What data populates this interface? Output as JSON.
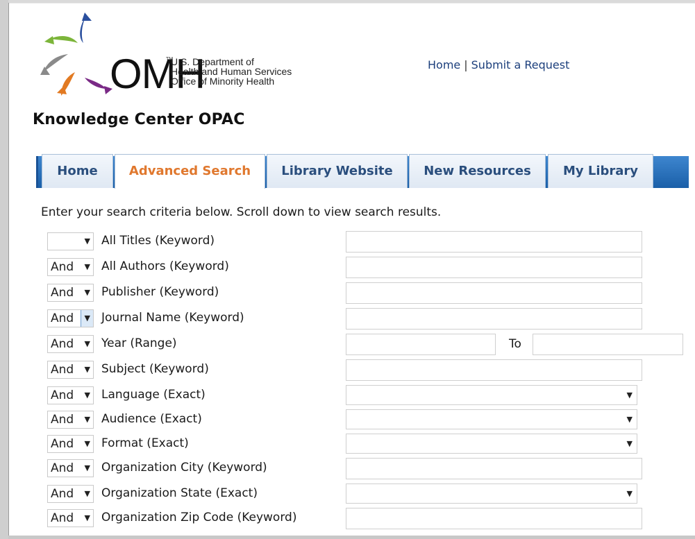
{
  "logo": {
    "letters": "OMH",
    "superscript": "TM",
    "line1": "U.S. Department of",
    "line2": "Health and Human Services",
    "line3": "Office of Minority Health"
  },
  "top_links": {
    "home": "Home",
    "separator": "|",
    "submit": "Submit a Request"
  },
  "page_title": "Knowledge Center OPAC",
  "tabs": [
    {
      "label": "Home",
      "active": false
    },
    {
      "label": "Advanced Search",
      "active": true
    },
    {
      "label": "Library Website",
      "active": false
    },
    {
      "label": "New Resources",
      "active": false
    },
    {
      "label": "My Library",
      "active": false
    }
  ],
  "instructions": "Enter your search criteria below. Scroll down to view search results.",
  "to_label": "To",
  "rows": [
    {
      "operator": "",
      "label": "All Titles (Keyword)",
      "input": "text"
    },
    {
      "operator": "And",
      "label": "All Authors (Keyword)",
      "input": "text"
    },
    {
      "operator": "And",
      "label": "Publisher (Keyword)",
      "input": "text"
    },
    {
      "operator": "And",
      "label": "Journal Name (Keyword)",
      "input": "text"
    },
    {
      "operator": "And",
      "label": "Year (Range)",
      "input": "range"
    },
    {
      "operator": "And",
      "label": "Subject (Keyword)",
      "input": "text"
    },
    {
      "operator": "And",
      "label": "Language (Exact)",
      "input": "select"
    },
    {
      "operator": "And",
      "label": "Audience (Exact)",
      "input": "select"
    },
    {
      "operator": "And",
      "label": "Format (Exact)",
      "input": "select"
    },
    {
      "operator": "And",
      "label": "Organization City (Keyword)",
      "input": "text"
    },
    {
      "operator": "And",
      "label": "Organization State (Exact)",
      "input": "select"
    },
    {
      "operator": "And",
      "label": "Organization Zip Code (Keyword)",
      "input": "text"
    }
  ],
  "colors": {
    "tab_bar": "#2a70bd",
    "active_tab_text": "#e0782e",
    "tab_text": "#2a4e7d",
    "link": "#1c3f7c"
  },
  "icons": {
    "dropdown": "caret-down-icon",
    "logo_mark": "omh-pinwheel-logo"
  }
}
